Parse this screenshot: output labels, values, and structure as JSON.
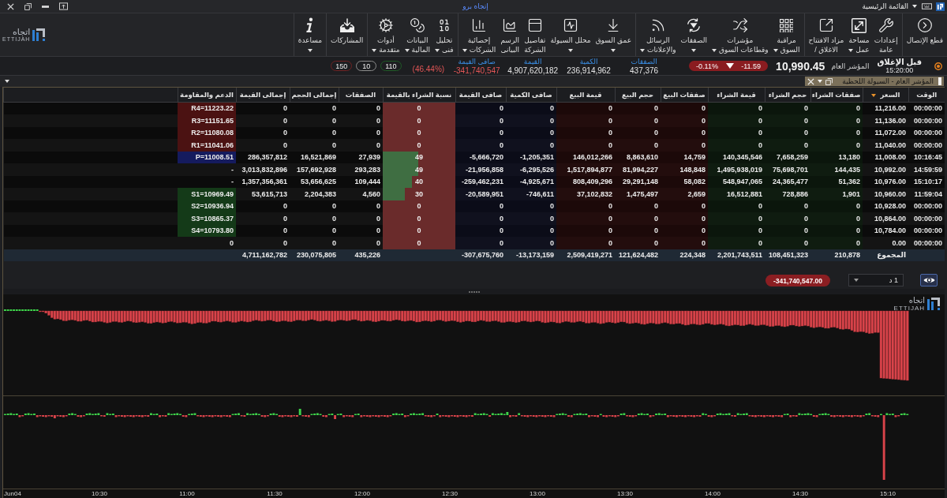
{
  "title_bar": {
    "menu": "القائمة الرئيسية",
    "app_title": "إتجاه برو"
  },
  "ribbon": {
    "groups": [
      [
        {
          "lines": [
            "قطع الإتصال"
          ],
          "has_menu": false
        }
      ],
      [
        {
          "lines": [
            "إعدادات",
            "عامة"
          ],
          "has_menu": false
        },
        {
          "lines": [
            "مساحة",
            "عمل"
          ],
          "has_menu": true
        },
        {
          "lines": [
            "مزاد الافتتاح",
            "الاغلاق /"
          ],
          "has_menu": false
        }
      ],
      [
        {
          "lines": [
            "مراقبة",
            "السوق"
          ],
          "has_menu": true
        },
        {
          "lines": [
            "مؤشرات",
            "وقطاعات السوق"
          ],
          "has_menu": true
        },
        {
          "lines": [
            "الصفقات"
          ],
          "has_menu": true
        },
        {
          "lines": [
            "الرسائل",
            "والإعلانات"
          ],
          "has_menu": true
        }
      ],
      [
        {
          "lines": [
            "عمق السوق"
          ],
          "has_menu": true
        },
        {
          "lines": [
            "محلل السيولة"
          ],
          "has_menu": true
        },
        {
          "lines": [
            "تفاصيل",
            "الشركة"
          ],
          "has_menu": false
        },
        {
          "lines": [
            "الرسم",
            "البيانى"
          ],
          "has_menu": false
        },
        {
          "lines": [
            "إحصائية",
            "الشركات"
          ],
          "has_menu": true
        }
      ],
      [
        {
          "lines": [
            "تحليل",
            "فنى"
          ],
          "has_menu": true
        },
        {
          "lines": [
            "البيانات",
            "المالية"
          ],
          "has_menu": true
        },
        {
          "lines": [
            "أدوات",
            "متقدمة"
          ],
          "has_menu": true
        }
      ],
      [
        {
          "lines": [
            "المشاركات"
          ],
          "has_menu": false
        }
      ],
      [
        {
          "lines": [
            "مساعدة"
          ],
          "has_menu": true
        }
      ]
    ],
    "logo": {
      "arabic": "اتجاه",
      "latin": "ETTIJAH"
    }
  },
  "quote": {
    "session": "قبل الإغلاق",
    "time": "15:20:00",
    "index_name": "المؤشر العام",
    "index_value": "10,990.45",
    "change": "-11.59",
    "change_pct": "-0.11%",
    "falling": true,
    "stats": [
      {
        "label": "الصفقات",
        "value": "437,376",
        "negative": false
      },
      {
        "label": "الكمية",
        "value": "236,914,962",
        "negative": false
      },
      {
        "label": "القيمة",
        "value": "4,907,620,182",
        "negative": false
      },
      {
        "label": "صافى القيمة",
        "value": "-341,740,547",
        "negative": true
      }
    ],
    "net_pct": "(46.44%)",
    "breadth": [
      {
        "value": "110",
        "kind": "up"
      },
      {
        "value": "10",
        "kind": "flat"
      },
      {
        "value": "150",
        "kind": "down"
      }
    ]
  },
  "panel": {
    "title": "المؤشر العام - السيولة اللحظية"
  },
  "table": {
    "columns": [
      {
        "label": "الوقت",
        "kind": "plain",
        "sorted": false
      },
      {
        "label": "السعر",
        "kind": "plain",
        "sorted": true
      },
      {
        "label": "صفقات الشراء",
        "kind": "buy",
        "sorted": false
      },
      {
        "label": "حجم الشراء",
        "kind": "buy",
        "sorted": false
      },
      {
        "label": "قيمة الشراء",
        "kind": "buy",
        "sorted": false
      },
      {
        "label": "صفقات البيع",
        "kind": "sell",
        "sorted": false
      },
      {
        "label": "حجم البيع",
        "kind": "sell",
        "sorted": false
      },
      {
        "label": "قيمة البيع",
        "kind": "sell",
        "sorted": false
      },
      {
        "label": "صافى الكمية",
        "kind": "net",
        "sorted": false
      },
      {
        "label": "صافى القيمة",
        "kind": "net",
        "sorted": false
      },
      {
        "label": "نسبة الشراء بالقيمة",
        "kind": "ratio",
        "sorted": false
      },
      {
        "label": "الصفقات",
        "kind": "plain",
        "sorted": false
      },
      {
        "label": "إجمالى الحجم",
        "kind": "plain",
        "sorted": false
      },
      {
        "label": "إجمالى القيمة",
        "kind": "plain",
        "sorted": false
      },
      {
        "label": "الدعم والمقاومة",
        "kind": "sr",
        "sorted": false
      }
    ],
    "rows": [
      {
        "cells": [
          "00:00:00",
          "11,216.00",
          "0",
          "0",
          "0",
          "0",
          "0",
          "0",
          "0",
          "0",
          "0",
          "0",
          "0",
          "0",
          "R4=11223.22"
        ],
        "level": 0,
        "kind": "resistance"
      },
      {
        "cells": [
          "00:00:00",
          "11,136.00",
          "0",
          "0",
          "0",
          "0",
          "0",
          "0",
          "0",
          "0",
          "0",
          "0",
          "0",
          "0",
          "R3=11151.65"
        ],
        "level": 0,
        "kind": "resistance"
      },
      {
        "cells": [
          "00:00:00",
          "11,072.00",
          "0",
          "0",
          "0",
          "0",
          "0",
          "0",
          "0",
          "0",
          "0",
          "0",
          "0",
          "0",
          "R2=11080.08"
        ],
        "level": 0,
        "kind": "resistance"
      },
      {
        "cells": [
          "00:00:00",
          "11,040.00",
          "0",
          "0",
          "0",
          "0",
          "0",
          "0",
          "0",
          "0",
          "0",
          "0",
          "0",
          "0",
          "R1=11041.06"
        ],
        "level": 0,
        "kind": "resistance"
      },
      {
        "cells": [
          "10:16:45",
          "11,008.00",
          "13,180",
          "7,658,259",
          "140,345,546",
          "14,759",
          "8,863,610",
          "146,012,266",
          "-1,205,351",
          "-5,666,720",
          "49",
          "27,939",
          "16,521,869",
          "286,357,812",
          "P=11008.51"
        ],
        "level": 0.49,
        "kind": "pivot"
      },
      {
        "cells": [
          "14:59:59",
          "10,992.00",
          "144,435",
          "75,698,701",
          "1,495,938,019",
          "148,848",
          "81,994,227",
          "1,517,894,877",
          "-6,295,526",
          "-21,956,858",
          "49",
          "293,283",
          "157,692,928",
          "3,013,832,896",
          "-"
        ],
        "level": 0.49,
        "kind": "plain"
      },
      {
        "cells": [
          "15:10:17",
          "10,976.00",
          "51,362",
          "24,365,477",
          "548,947,065",
          "58,082",
          "29,291,148",
          "808,409,296",
          "-4,925,671",
          "-259,462,231",
          "40",
          "109,444",
          "53,656,625",
          "1,357,356,361",
          "-"
        ],
        "level": 0.4,
        "kind": "plain"
      },
      {
        "cells": [
          "11:59:04",
          "10,960.00",
          "1,901",
          "728,886",
          "16,512,881",
          "2,659",
          "1,475,497",
          "37,102,832",
          "-746,611",
          "-20,589,951",
          "30",
          "4,560",
          "2,204,383",
          "53,615,713",
          "S1=10969.49"
        ],
        "level": 0.3,
        "kind": "support"
      },
      {
        "cells": [
          "00:00:00",
          "10,928.00",
          "0",
          "0",
          "0",
          "0",
          "0",
          "0",
          "0",
          "0",
          "0",
          "0",
          "0",
          "0",
          "S2=10936.94"
        ],
        "level": 0,
        "kind": "support"
      },
      {
        "cells": [
          "00:00:00",
          "10,864.00",
          "0",
          "0",
          "0",
          "0",
          "0",
          "0",
          "0",
          "0",
          "0",
          "0",
          "0",
          "0",
          "S3=10865.37"
        ],
        "level": 0,
        "kind": "support"
      },
      {
        "cells": [
          "00:00:00",
          "10,784.00",
          "0",
          "0",
          "0",
          "0",
          "0",
          "0",
          "0",
          "0",
          "0",
          "0",
          "0",
          "0",
          "S4=10793.80"
        ],
        "level": 0,
        "kind": "support"
      },
      {
        "cells": [
          "00:00:00",
          "0.00",
          "0",
          "0",
          "0",
          "0",
          "0",
          "0",
          "0",
          "0",
          "0",
          "0",
          "0",
          "0",
          "0"
        ],
        "level": 0,
        "kind": "plain"
      }
    ],
    "total": {
      "label": "المجموع",
      "flow_values": [
        "210,878",
        "108,451,323",
        "2,201,743,511",
        "224,348",
        "121,624,482",
        "2,509,419,271",
        "-13,173,159",
        "-307,675,760"
      ],
      "overall_values": [
        "435,226",
        "230,075,805",
        "4,711,162,782"
      ]
    }
  },
  "chart_toolbar": {
    "net_value": "-341,740,547.00",
    "interval": "1 د"
  },
  "chart": {
    "logo": {
      "arabic": "اتجاه",
      "latin": "ETTIJAH"
    },
    "time_labels": [
      "15:10",
      "14:30",
      "14:00",
      "13:30",
      "13:00",
      "12:30",
      "12:00",
      "11:30",
      "11:00",
      "10:30",
      "Jun04"
    ]
  }
}
